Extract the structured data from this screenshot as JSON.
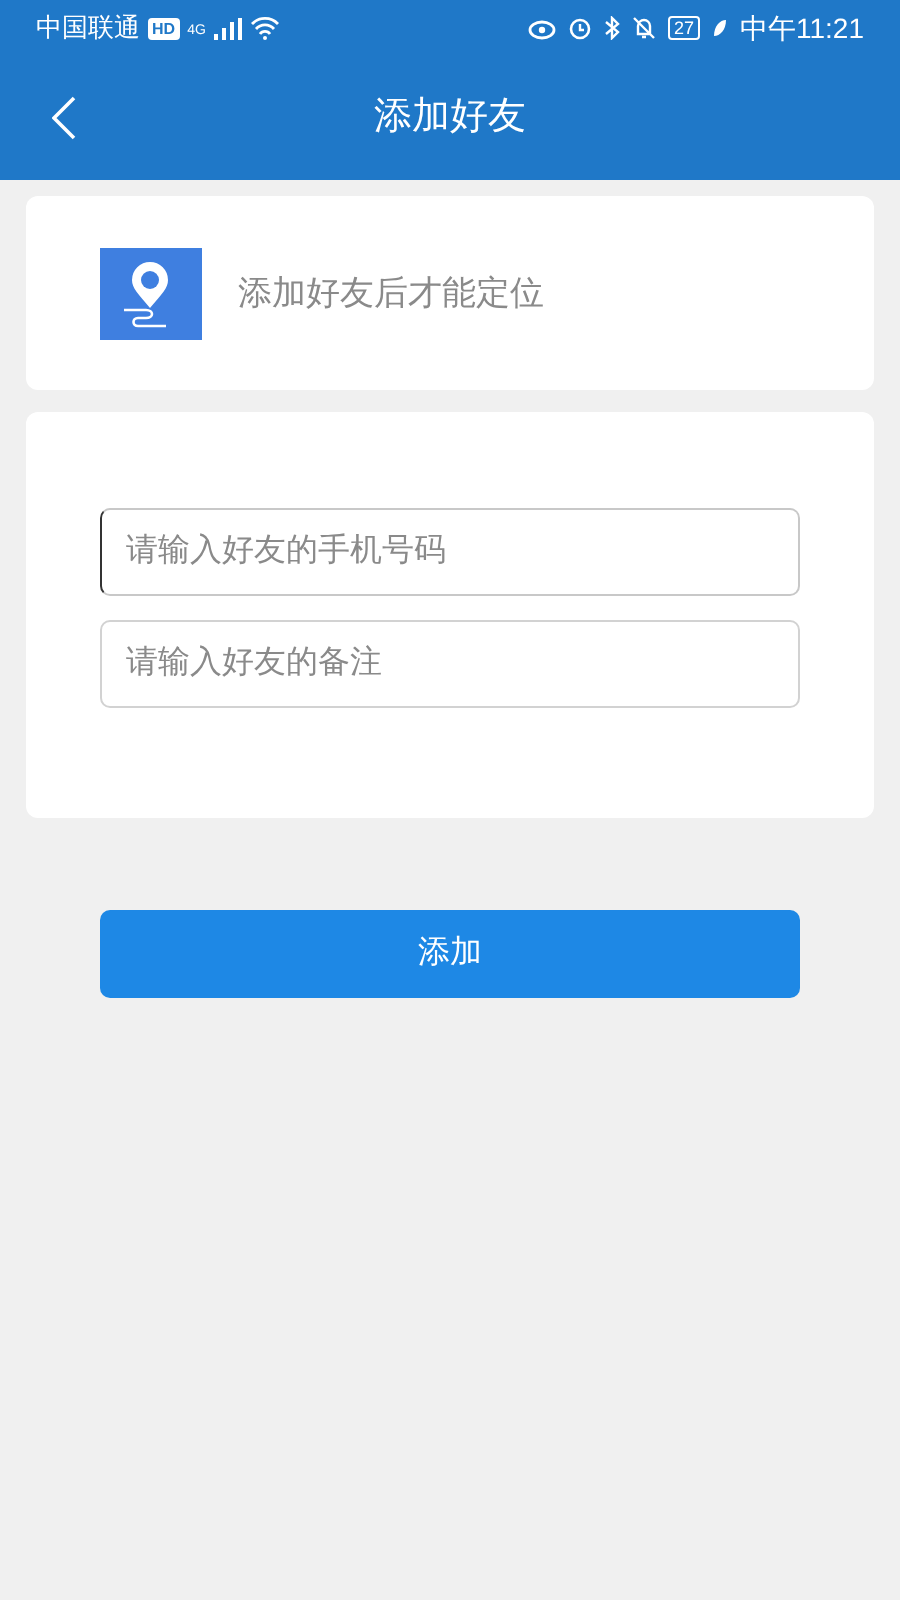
{
  "status_bar": {
    "carrier": "中国联通",
    "hd_badge": "HD",
    "network": "4G",
    "battery": "27",
    "time": "中午11:21"
  },
  "header": {
    "title": "添加好友"
  },
  "info_card": {
    "text": "添加好友后才能定位"
  },
  "form": {
    "fields": [
      {
        "placeholder": "请输入好友的手机号码",
        "focused": true
      },
      {
        "placeholder": "请输入好友的备注",
        "focused": false
      }
    ]
  },
  "submit_button": {
    "label": "添加"
  }
}
